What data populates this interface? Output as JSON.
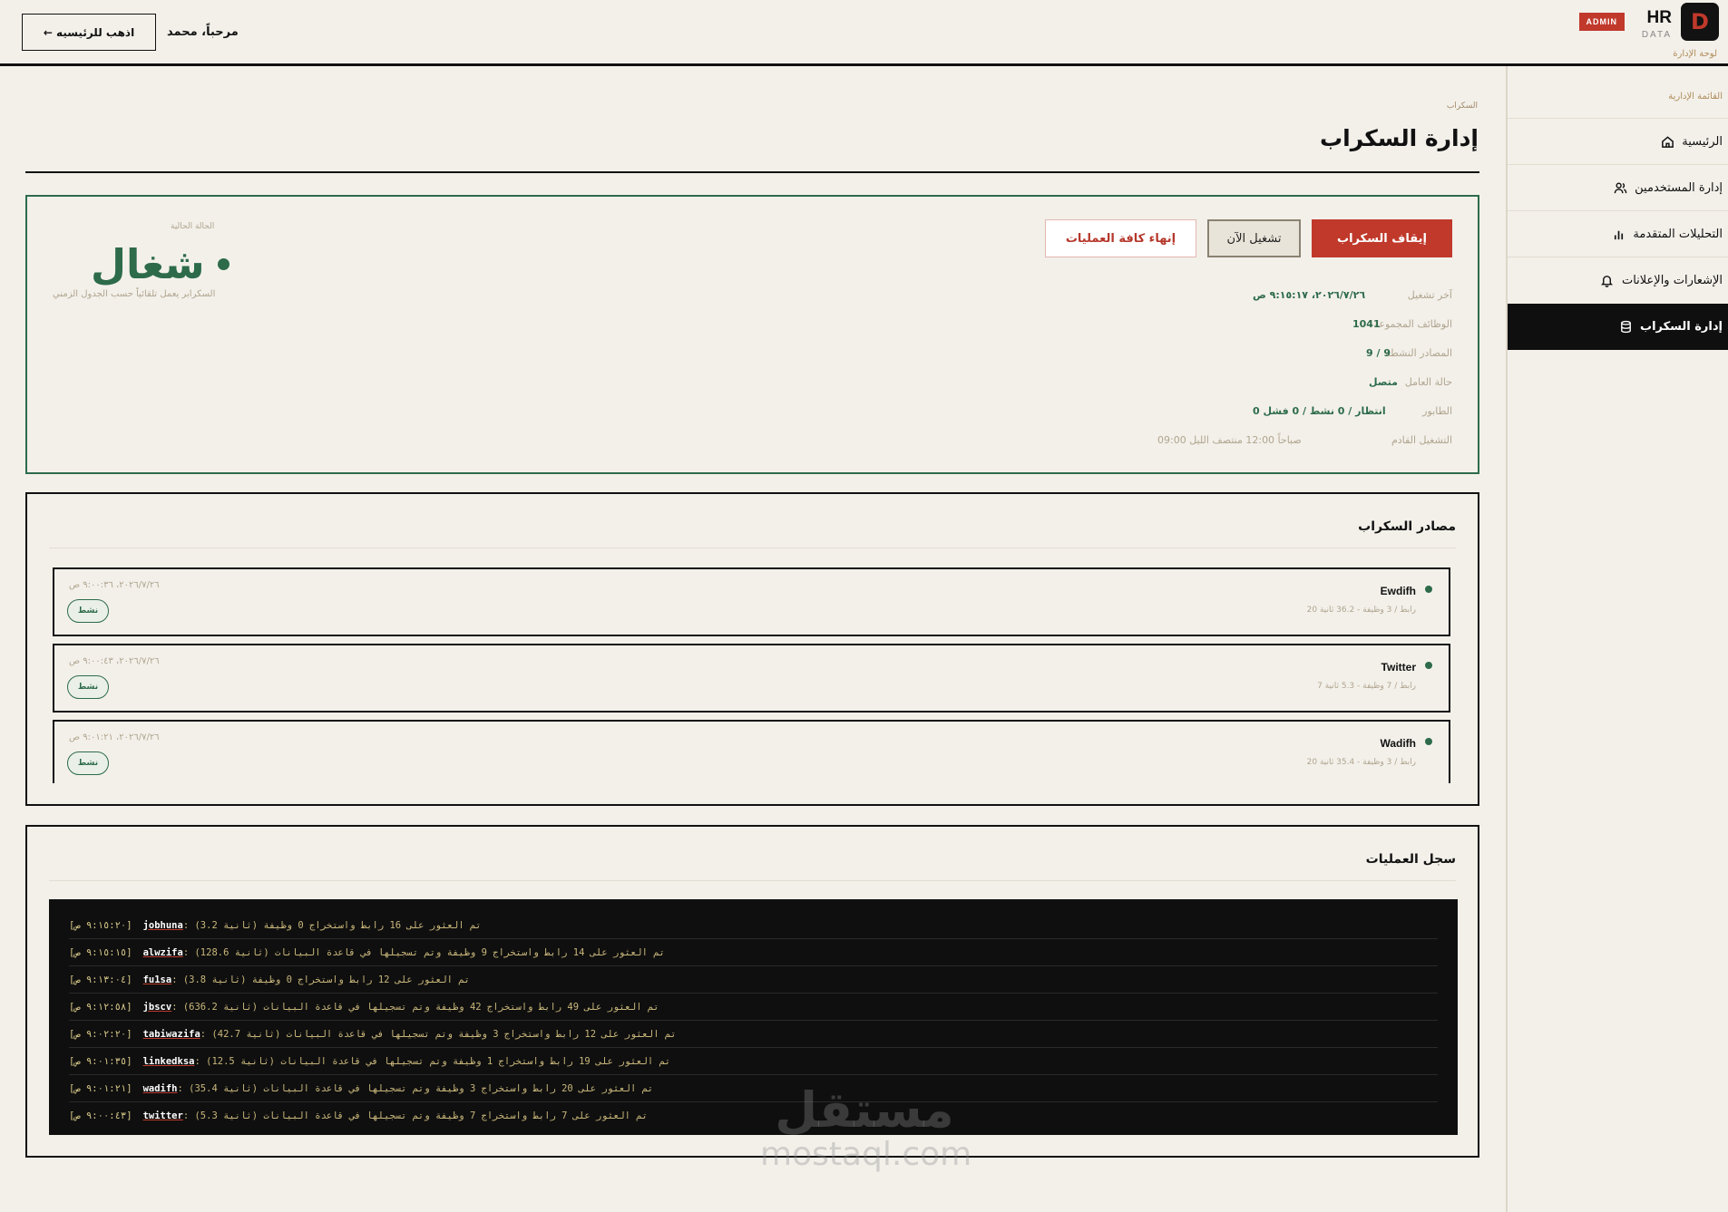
{
  "header": {
    "brand_mark": "D",
    "brand_title": "HR",
    "brand_subtitle": "DATA",
    "role_badge": "ADMIN",
    "dashboard_label": "لوحة الإدارة",
    "greeting": "مرحباً، محمد",
    "home_button": "← اذهب للرئيسيه"
  },
  "sidebar": {
    "title": "القائمة الإدارية",
    "items": [
      {
        "label": "الرئيسية",
        "icon": "home-icon",
        "active": false
      },
      {
        "label": "إدارة المستخدمين",
        "icon": "users-icon",
        "active": false
      },
      {
        "label": "التحليلات المتقدمة",
        "icon": "bar-chart-icon",
        "active": false
      },
      {
        "label": "الإشعارات والإعلانات",
        "icon": "bell-icon",
        "active": false
      },
      {
        "label": "إدارة السكراب",
        "icon": "database-icon",
        "active": true
      }
    ]
  },
  "page": {
    "breadcrumb": "السكراب",
    "title": "إدارة السكراب"
  },
  "status": {
    "stop_button": "إيقاف السكراب",
    "run_button": "تشغيل الآن",
    "kill_button": "إنهاء كافة العمليات",
    "current_label": "الحالة الحالية",
    "state": "شغال",
    "state_sub": "السكرابر يعمل تلقائياً حسب الجدول الزمني",
    "fields": [
      {
        "key": "آخر تشغيل",
        "value": "٢٠٢٦/٧/٢٦، ٩:١٥:١٧ ص"
      },
      {
        "key": "الوظائف المجموعة",
        "value": "1041"
      },
      {
        "key": "المصادر النشطة",
        "value": "9 / 9"
      },
      {
        "key": "حالة العامل",
        "value": "متصل"
      },
      {
        "key": "الطابور",
        "value": "0 انتظار / 0 نشط / 0 فشل"
      },
      {
        "key": "التشغيل القادم",
        "value": "09:00 صباحاً 12:00 منتصف الليل"
      }
    ]
  },
  "sources": {
    "title": "مصادر السكراب",
    "items": [
      {
        "name": "Ewdifh",
        "meta": "20 رابط / 3 وظيفة - 36.2 ثانية",
        "date": "٢٠٢٦/٧/٢٦، ٩:٠٠:٣٦ ص",
        "badge": "نشط"
      },
      {
        "name": "Twitter",
        "meta": "7 رابط / 7 وظيفة - 5.3 ثانية",
        "date": "٢٠٢٦/٧/٢٦، ٩:٠٠:٤٣ ص",
        "badge": "نشط"
      },
      {
        "name": "Wadifh",
        "meta": "20 رابط / 3 وظيفة - 35.4 ثانية",
        "date": "٢٠٢٦/٧/٢٦، ٩:٠١:٢١ ص",
        "badge": "نشط"
      }
    ]
  },
  "log": {
    "title": "سجل العمليات",
    "lines": [
      {
        "time": "[٩:١٥:٢٠ ص]",
        "source": "jobhuna",
        "message": ": (3.2 ثانية) تم العثور على 16 رابط واستخراج 0 وظيفة"
      },
      {
        "time": "[٩:١٥:١٥ ص]",
        "source": "alwzifa",
        "message": ": (128.6 ثانية) تم العثور على 14 رابط واستخراج 9 وظيفة وتم تسجيلها في قاعدة البيانات"
      },
      {
        "time": "[٩:١٣:٠٤ ص]",
        "source": "fu1sa",
        "message": ": (3.8 ثانية) تم العثور على 12 رابط واستخراج 0 وظيفة"
      },
      {
        "time": "[٩:١٢:٥٨ ص]",
        "source": "jbscv",
        "message": ": (636.2 ثانية) تم العثور على 49 رابط واستخراج 42 وظيفة وتم تسجيلها في قاعدة البيانات"
      },
      {
        "time": "[٩:٠٢:٢٠ ص]",
        "source": "tabiwazifa",
        "message": ": (42.7 ثانية) تم العثور على 12 رابط واستخراج 3 وظيفة وتم تسجيلها في قاعدة البيانات"
      },
      {
        "time": "[٩:٠١:٣٥ ص]",
        "source": "linkedksa",
        "message": ": (12.5 ثانية) تم العثور على 19 رابط واستخراج 1 وظيفة وتم تسجيلها في قاعدة البيانات"
      },
      {
        "time": "[٩:٠١:٢١ ص]",
        "source": "wadifh",
        "message": ": (35.4 ثانية) تم العثور على 20 رابط واستخراج 3 وظيفة وتم تسجيلها في قاعدة البيانات"
      },
      {
        "time": "[٩:٠٠:٤٣ ص]",
        "source": "twitter",
        "message": ": (5.3 ثانية) تم العثور على 7 رابط واستخراج 7 وظيفة وتم تسجيلها في قاعدة البيانات"
      }
    ]
  },
  "watermark": {
    "arabic": "مستقل",
    "latin": "mostaql.com"
  },
  "colors": {
    "accent_red": "#c0392b",
    "accent_green": "#2d6b4a",
    "background": "#f3f0ea",
    "dark": "#0f0f0f"
  }
}
